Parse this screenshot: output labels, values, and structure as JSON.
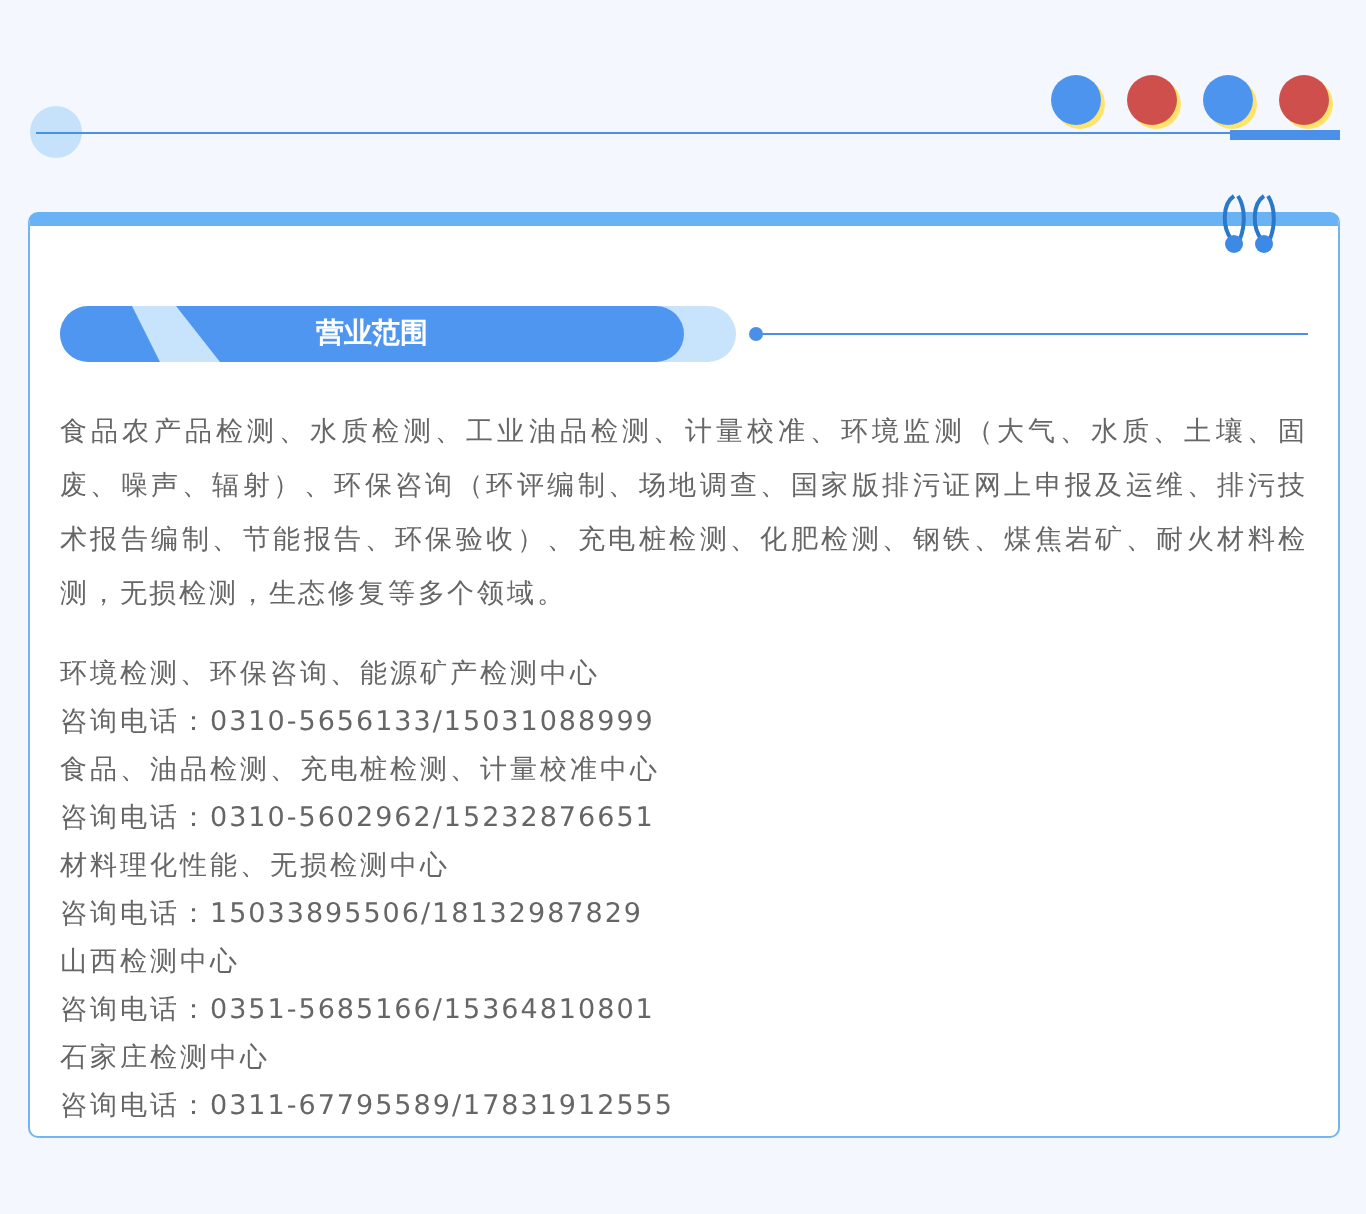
{
  "section": {
    "title": "营业范围",
    "description": "食品农产品检测、水质检测、工业油品检测、计量校准、环境监测（大气、水质、土壤、固废、噪声、辐射）、环保咨询（环评编制、场地调查、国家版排污证网上申报及运维、排污技术报告编制、节能报告、环保验收）、充电桩检测、化肥检测、钢铁、煤焦岩矿、耐火材料检测，无损检测，生态修复等多个领域。",
    "centers": [
      {
        "name": "环境检测、环保咨询、能源矿产检测中心",
        "phone": "咨询电话：0310-5656133/15031088999"
      },
      {
        "name": "食品、油品检测、充电桩检测、计量校准中心",
        "phone": "咨询电话：0310-5602962/15232876651"
      },
      {
        "name": "材料理化性能、无损检测中心",
        "phone": "咨询电话：15033895506/18132987829"
      },
      {
        "name": "山西检测中心",
        "phone": "咨询电话：0351-5685166/15364810801"
      },
      {
        "name": "石家庄检测中心",
        "phone": "咨询电话：0311-67795589/17831912555"
      }
    ]
  }
}
